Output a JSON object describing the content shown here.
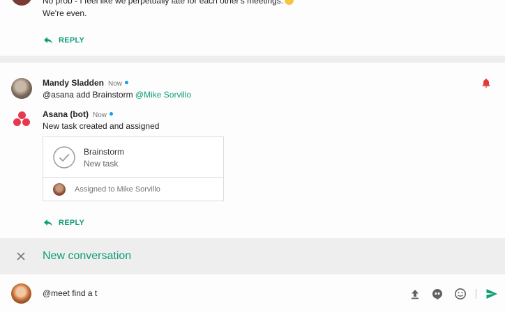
{
  "previous_thread": {
    "message_line1": "No prob - I feel like we perpetually late for each other's meetings.",
    "message_line2": "We're even.",
    "reply_label": "REPLY"
  },
  "thread": {
    "messages": [
      {
        "author": "Mandy Sladden",
        "time": "Now",
        "text": "@asana add Brainstorm ",
        "mention": "@Mike Sorvillo"
      },
      {
        "author": "Asana (bot)",
        "time": "Now",
        "text": "New task created and assigned"
      }
    ],
    "card": {
      "task_title": "Brainstorm",
      "task_subtitle": "New task",
      "assigned_text": "Assigned to Mike Sorvillo"
    },
    "reply_label": "REPLY",
    "bell_color": "#e53935"
  },
  "new_conversation": {
    "label": "New conversation"
  },
  "compose": {
    "value": "@meet find a t",
    "icons": [
      "upload-icon",
      "hangouts-icon",
      "emoji-icon",
      "send-icon"
    ]
  },
  "colors": {
    "accent": "#0f9d77",
    "presence": "#1a9be6",
    "asana": "#e8384f"
  }
}
